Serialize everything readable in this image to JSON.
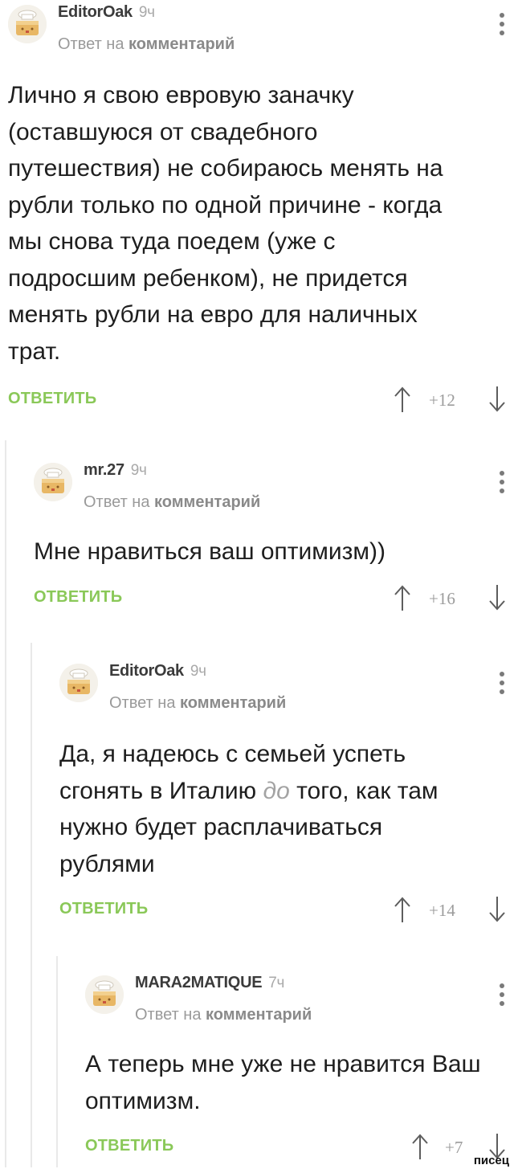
{
  "reply_to_text": "Ответ на",
  "reply_to_link": "комментарий",
  "reply_label": "ОТВЕТИТЬ",
  "comments": [
    {
      "author": "EditorOak",
      "time": "9ч",
      "text": "Лично я свою евровую заначку (оставшуюся от свадебного путешествия) не собираюсь менять на рубли только по одной причине - когда мы снова туда поедем (уже с подросшим ребенком), не придется менять рубли на евро для наличных трат.",
      "rating": "+12"
    },
    {
      "author": "mr.27",
      "time": "9ч",
      "text": "Мне нравиться ваш оптимизм))",
      "rating": "+16"
    },
    {
      "author": "EditorOak",
      "time": "9ч",
      "text_before": "Да, я надеюсь с семьей успеть сгонять в Италию",
      "text_emph": "до",
      "text_after": "того, как там нужно будет расплачиваться рублями",
      "rating": "+14"
    },
    {
      "author": "MARA2MATIQUE",
      "time": "7ч",
      "text": "А теперь мне уже не нравится Ваш оптимизм.",
      "rating": "+7"
    }
  ],
  "watermark": "писец"
}
